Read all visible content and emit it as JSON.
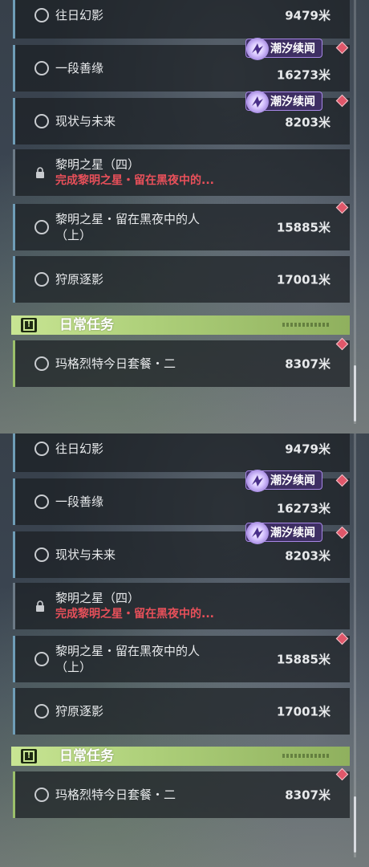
{
  "panels": [
    {
      "quests": [
        {
          "title": "往日幻影",
          "distance": "9479米",
          "icon": "circle-icon"
        },
        {
          "title": "一段善缘",
          "distance": "16273米",
          "icon": "circle-icon",
          "badge": "潮汐续闻"
        },
        {
          "title": "现状与未来",
          "distance": "8203米",
          "icon": "circle-icon",
          "badge": "潮汐续闻"
        },
        {
          "title": "黎明之星（四）",
          "subtitle": "完成黎明之星・留在黑夜中的...",
          "icon": "lock-icon"
        },
        {
          "title": "黎明之星・留在黑夜中的人（上）",
          "distance": "15885米",
          "icon": "circle-icon"
        },
        {
          "title": "狩原逐影",
          "distance": "17001米",
          "icon": "circle-icon"
        }
      ],
      "daily": {
        "header": "日常任务",
        "quests": [
          {
            "title": "玛格烈特今日套餐・二",
            "distance": "8307米",
            "icon": "circle-icon"
          }
        ]
      }
    },
    {
      "quests": [
        {
          "title": "往日幻影",
          "distance": "9479米",
          "icon": "circle-icon"
        },
        {
          "title": "一段善缘",
          "distance": "16273米",
          "icon": "circle-icon",
          "badge": "潮汐续闻"
        },
        {
          "title": "现状与未来",
          "distance": "8203米",
          "icon": "circle-icon",
          "badge": "潮汐续闻"
        },
        {
          "title": "黎明之星（四）",
          "subtitle": "完成黎明之星・留在黑夜中的...",
          "icon": "lock-icon"
        },
        {
          "title": "黎明之星・留在黑夜中的人（上）",
          "distance": "15885米",
          "icon": "circle-icon"
        },
        {
          "title": "狩原逐影",
          "distance": "17001米",
          "icon": "circle-icon"
        }
      ],
      "daily": {
        "header": "日常任务",
        "quests": [
          {
            "title": "玛格烈特今日套餐・二",
            "distance": "8307米",
            "icon": "circle-icon"
          }
        ]
      }
    }
  ],
  "colors": {
    "alert_diamond": "#e0576a",
    "badge_purple": "#3e2f63",
    "daily_green": "#aed07a",
    "locked_red": "#e8505a",
    "accent_blue": "#6f9db7"
  }
}
